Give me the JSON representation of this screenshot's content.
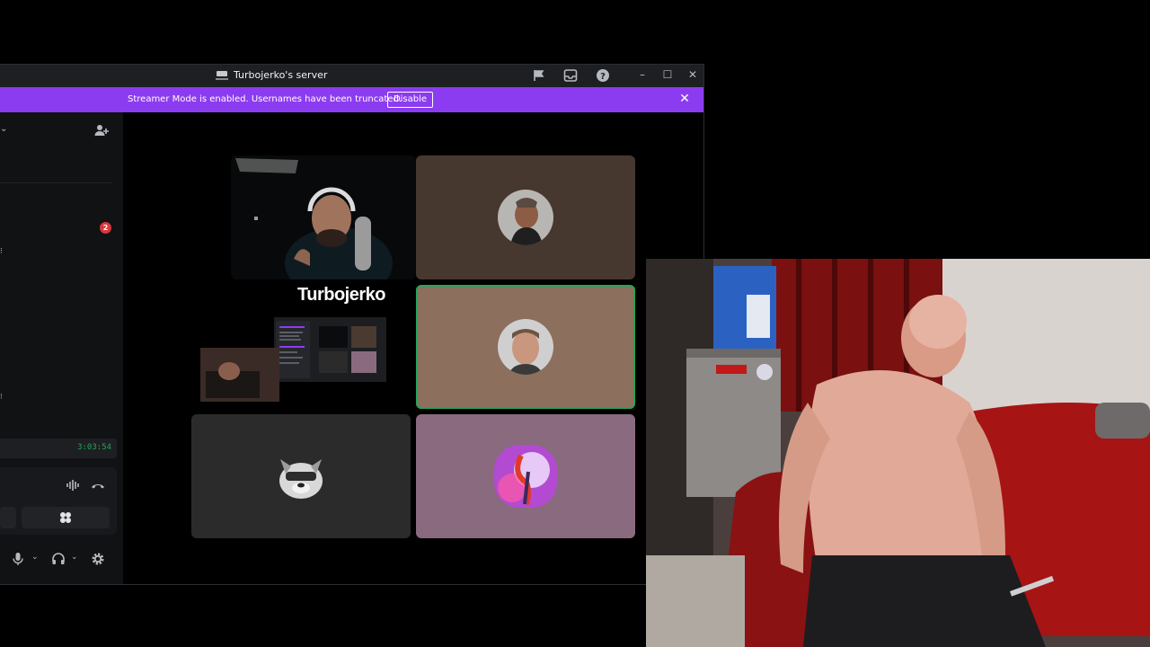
{
  "window": {
    "title": "Turbojerko's server"
  },
  "banner": {
    "message": "Streamer Mode is enabled. Usernames have been truncated.",
    "disable_label": "Disable"
  },
  "sidebar": {
    "unread_badge": "2",
    "call_timer": "3:03:54"
  },
  "stage": {
    "stream_title": "Turbojerko"
  },
  "colors": {
    "banner": "#8c3cf0",
    "speaking_ring": "#23a55a",
    "badge": "#da373c",
    "tile_brown": "#46382f",
    "tile_tan": "#8c6f5c",
    "tile_grey": "#2b2b2b",
    "tile_mauve": "#8a6a7e"
  }
}
